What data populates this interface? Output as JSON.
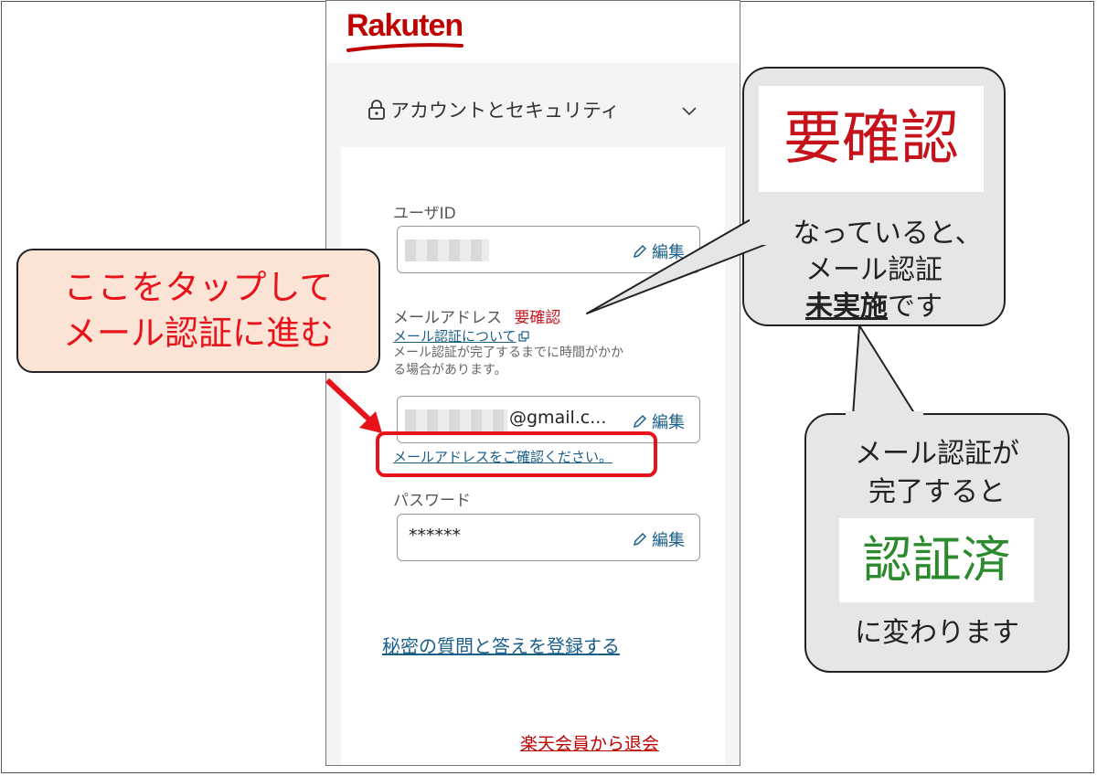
{
  "app": {
    "logo_text": "Rakuten",
    "section_title": "アカウントとセキュリティ"
  },
  "user_id": {
    "label": "ユーザID",
    "edit_label": "編集"
  },
  "email": {
    "label": "メールアドレス",
    "status_badge": "要確認",
    "about_link": "メール認証について",
    "note": "メール認証が完了するまでに時間がかか",
    "note2": "る場合があります。",
    "value_suffix": "@gmail.c...",
    "edit_label": "編集",
    "confirm_link": "メールアドレスをご確認ください。"
  },
  "password": {
    "label": "パスワード",
    "value": "******",
    "edit_label": "編集"
  },
  "links": {
    "secret_question": "秘密の質問と答えを登録する",
    "withdraw": "楽天会員から退会"
  },
  "annotations": {
    "tap_note_line1": "ここをタップして",
    "tap_note_line2": "メール認証に進む",
    "status_pending": "要確認",
    "pending_line1": "になっていると、",
    "pending_line2": "メール認証",
    "pending_emph": "未実施",
    "pending_tail": "です",
    "done_line1": "メール認証が",
    "done_line2": "完了すると",
    "status_done": "認証済",
    "done_line3": "に変わります"
  },
  "colors": {
    "brand": "#bf0000",
    "link": "#1a5f8a",
    "alert": "#e8121b",
    "verified": "#2b8a2b"
  }
}
